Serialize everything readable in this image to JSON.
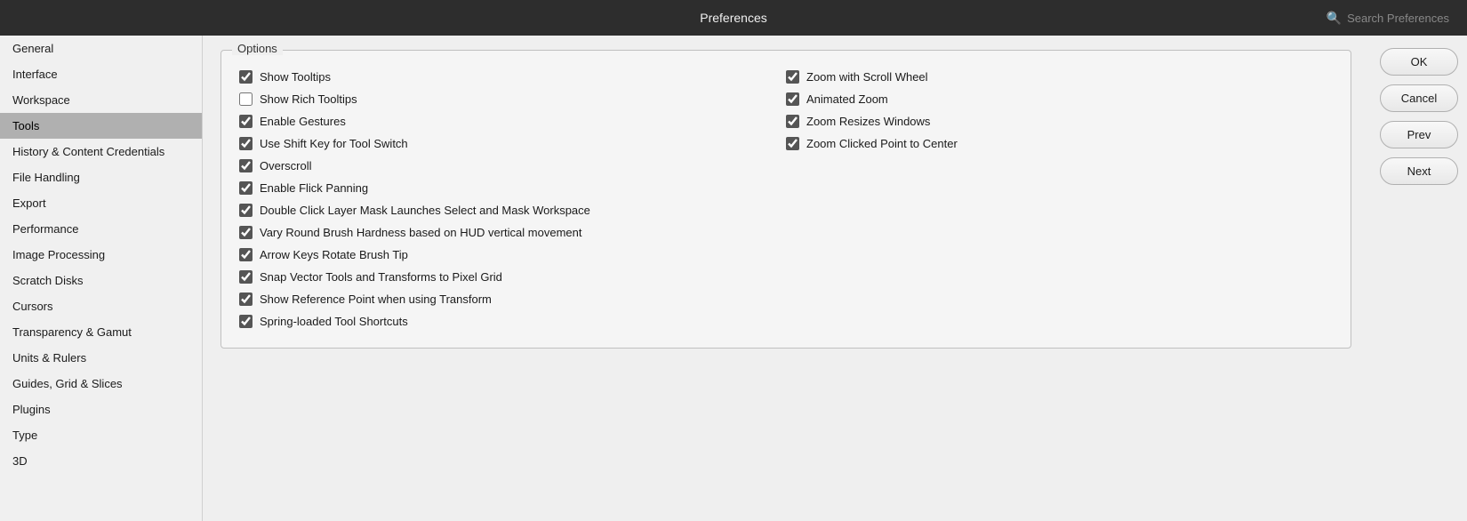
{
  "titlebar": {
    "title": "Preferences",
    "search_placeholder": "Search Preferences"
  },
  "sidebar": {
    "items": [
      {
        "id": "general",
        "label": "General",
        "active": false
      },
      {
        "id": "interface",
        "label": "Interface",
        "active": false
      },
      {
        "id": "workspace",
        "label": "Workspace",
        "active": false
      },
      {
        "id": "tools",
        "label": "Tools",
        "active": true
      },
      {
        "id": "history-content-credentials",
        "label": "History & Content Credentials",
        "active": false
      },
      {
        "id": "file-handling",
        "label": "File Handling",
        "active": false
      },
      {
        "id": "export",
        "label": "Export",
        "active": false
      },
      {
        "id": "performance",
        "label": "Performance",
        "active": false
      },
      {
        "id": "image-processing",
        "label": "Image Processing",
        "active": false
      },
      {
        "id": "scratch-disks",
        "label": "Scratch Disks",
        "active": false
      },
      {
        "id": "cursors",
        "label": "Cursors",
        "active": false
      },
      {
        "id": "transparency-gamut",
        "label": "Transparency & Gamut",
        "active": false
      },
      {
        "id": "units-rulers",
        "label": "Units & Rulers",
        "active": false
      },
      {
        "id": "guides-grid-slices",
        "label": "Guides, Grid & Slices",
        "active": false
      },
      {
        "id": "plugins",
        "label": "Plugins",
        "active": false
      },
      {
        "id": "type",
        "label": "Type",
        "active": false
      },
      {
        "id": "3d",
        "label": "3D",
        "active": false
      }
    ]
  },
  "content": {
    "options_legend": "Options",
    "left_column": [
      {
        "id": "show-tooltips",
        "label": "Show Tooltips",
        "checked": true
      },
      {
        "id": "show-rich-tooltips",
        "label": "Show Rich Tooltips",
        "checked": false
      },
      {
        "id": "enable-gestures",
        "label": "Enable Gestures",
        "checked": true
      },
      {
        "id": "use-shift-key",
        "label": "Use Shift Key for Tool Switch",
        "checked": true
      },
      {
        "id": "overscroll",
        "label": "Overscroll",
        "checked": true
      },
      {
        "id": "enable-flick-panning",
        "label": "Enable Flick Panning",
        "checked": true
      },
      {
        "id": "double-click-layer-mask",
        "label": "Double Click Layer Mask Launches Select and Mask Workspace",
        "checked": true
      },
      {
        "id": "vary-round-brush",
        "label": "Vary Round Brush Hardness based on HUD vertical movement",
        "checked": true
      },
      {
        "id": "arrow-keys-rotate",
        "label": "Arrow Keys Rotate Brush Tip",
        "checked": true
      },
      {
        "id": "snap-vector-tools",
        "label": "Snap Vector Tools and Transforms to Pixel Grid",
        "checked": true
      },
      {
        "id": "show-reference-point",
        "label": "Show Reference Point when using Transform",
        "checked": true
      },
      {
        "id": "spring-loaded-shortcuts",
        "label": "Spring-loaded Tool Shortcuts",
        "checked": true
      }
    ],
    "right_column": [
      {
        "id": "zoom-scroll-wheel",
        "label": "Zoom with Scroll Wheel",
        "checked": true
      },
      {
        "id": "animated-zoom",
        "label": "Animated Zoom",
        "checked": true
      },
      {
        "id": "zoom-resizes-windows",
        "label": "Zoom Resizes Windows",
        "checked": true
      },
      {
        "id": "zoom-clicked-point",
        "label": "Zoom Clicked Point to Center",
        "checked": true
      }
    ]
  },
  "buttons": {
    "ok": "OK",
    "cancel": "Cancel",
    "prev": "Prev",
    "next": "Next"
  }
}
